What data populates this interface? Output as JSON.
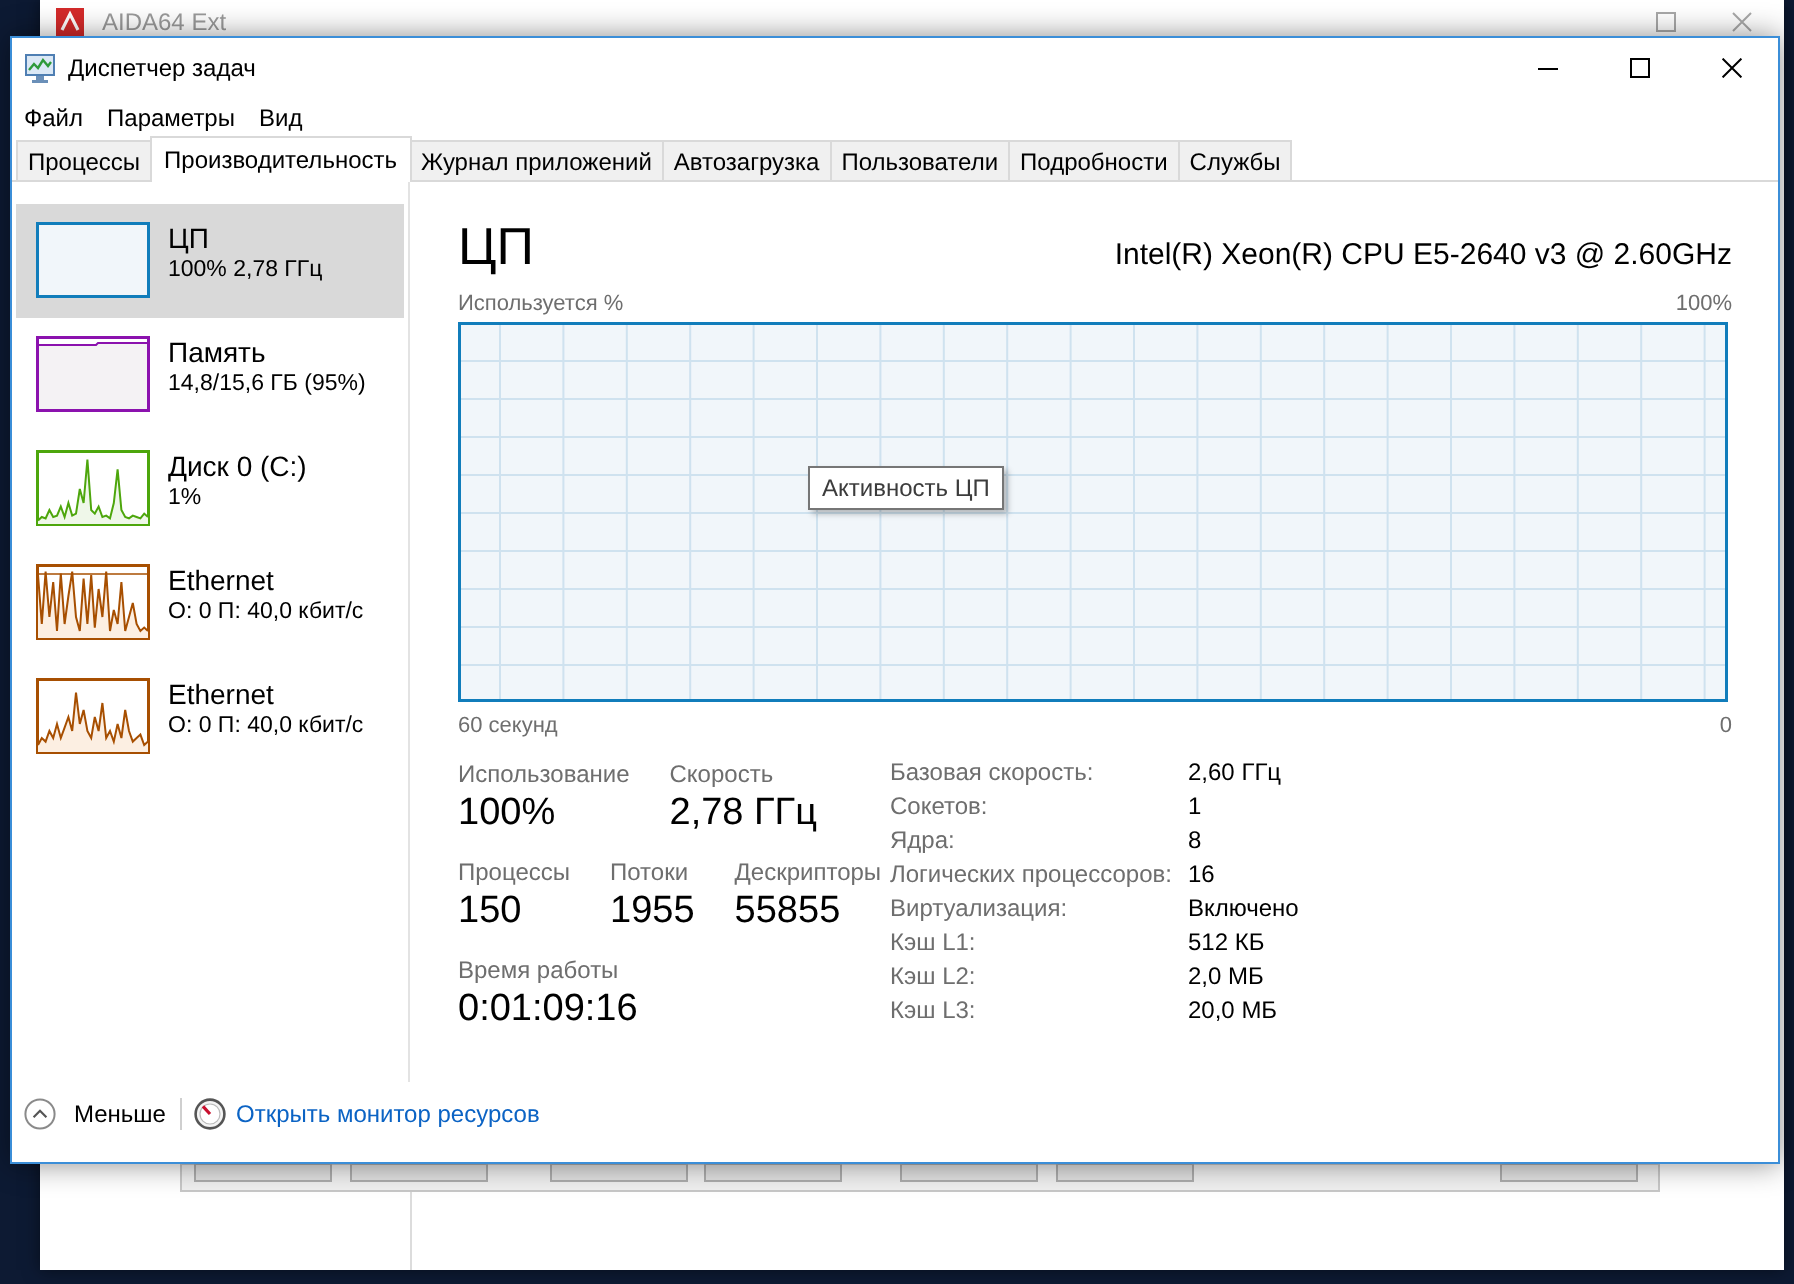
{
  "background_window": {
    "title": "AIDA64 Ext"
  },
  "window": {
    "title": "Диспетчер задач"
  },
  "menu": [
    "Файл",
    "Параметры",
    "Вид"
  ],
  "tabs": [
    {
      "label": "Процессы",
      "selected": false
    },
    {
      "label": "Производительность",
      "selected": true
    },
    {
      "label": "Журнал приложений",
      "selected": false
    },
    {
      "label": "Автозагрузка",
      "selected": false
    },
    {
      "label": "Пользователи",
      "selected": false
    },
    {
      "label": "Подробности",
      "selected": false
    },
    {
      "label": "Службы",
      "selected": false
    }
  ],
  "sidebar": {
    "items": [
      {
        "kind": "cpu",
        "name": "ЦП",
        "detail": "100% 2,78 ГГц",
        "selected": true
      },
      {
        "kind": "memory",
        "name": "Память",
        "detail": "14,8/15,6 ГБ (95%)",
        "selected": false
      },
      {
        "kind": "disk",
        "name": "Диск 0 (C:)",
        "detail": "1%",
        "selected": false
      },
      {
        "kind": "network",
        "name": "Ethernet",
        "detail": "О: 0 П: 40,0 кбит/с",
        "selected": false
      },
      {
        "kind": "network",
        "name": "Ethernet",
        "detail": "О: 0 П: 40,0 кбит/с",
        "selected": false
      }
    ]
  },
  "detail": {
    "title": "ЦП",
    "model": "Intel(R) Xeon(R) CPU E5-2640 v3 @ 2.60GHz",
    "graph": {
      "y_label": "Используется %",
      "y_max": "100%",
      "tooltip": "Активность ЦП",
      "x_start": "60 секунд",
      "x_end": "0"
    },
    "stats": [
      [
        {
          "label": "Использование",
          "value": "100%"
        },
        {
          "label": "Скорость",
          "value": "2,78 ГГц"
        }
      ],
      [
        {
          "label": "Процессы",
          "value": "150"
        },
        {
          "label": "Потоки",
          "value": "1955"
        },
        {
          "label": "Дескрипторы",
          "value": "55855"
        }
      ],
      [
        {
          "label": "Время работы",
          "value": "0:01:09:16"
        }
      ]
    ],
    "properties": [
      {
        "label": "Базовая скорость:",
        "value": "2,60 ГГц"
      },
      {
        "label": "Сокетов:",
        "value": "1"
      },
      {
        "label": "Ядра:",
        "value": "8"
      },
      {
        "label": "Логических процессоров:",
        "value": "16"
      },
      {
        "label": "Виртуализация:",
        "value": "Включено"
      },
      {
        "label": "Кэш L1:",
        "value": "512 КБ"
      },
      {
        "label": "Кэш L2:",
        "value": "2,0 МБ"
      },
      {
        "label": "Кэш L3:",
        "value": "20,0 МБ"
      }
    ]
  },
  "footer": {
    "less_button": "Меньше",
    "link": "Открыть монитор ресурсов"
  }
}
